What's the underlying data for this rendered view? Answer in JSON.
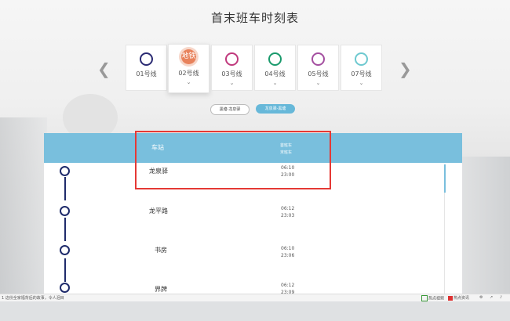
{
  "page": {
    "title": "首末班车时刻表"
  },
  "lines": [
    {
      "label": "01号线",
      "color": "#2b2b73"
    },
    {
      "label": "02号线",
      "color": "#e8825c",
      "active": true,
      "icon": "地铁"
    },
    {
      "label": "03号线",
      "color": "#c0397d"
    },
    {
      "label": "04号线",
      "color": "#1a9a6c"
    },
    {
      "label": "05号线",
      "color": "#a44fa0"
    },
    {
      "label": "07号线",
      "color": "#6ec9d0"
    }
  ],
  "directions": {
    "a": "黑塘-龙泉驿",
    "b": "龙泉驿-黑塘"
  },
  "table": {
    "col_station": "车站",
    "col_first": "首班车",
    "col_last": "末班车",
    "rows": [
      {
        "station": "龙泉驿",
        "first": "06:10",
        "last": "23:00"
      },
      {
        "station": "龙平路",
        "first": "06:12",
        "last": "23:03"
      },
      {
        "station": "书房",
        "first": "06:10",
        "last": "23:06"
      },
      {
        "station": "界牌",
        "first": "06:12",
        "last": "23:09"
      }
    ]
  },
  "statusbar": {
    "left": "1 这份全家福背后的故事，令人泪目",
    "video": "热点视频",
    "news": "热点资讯"
  }
}
